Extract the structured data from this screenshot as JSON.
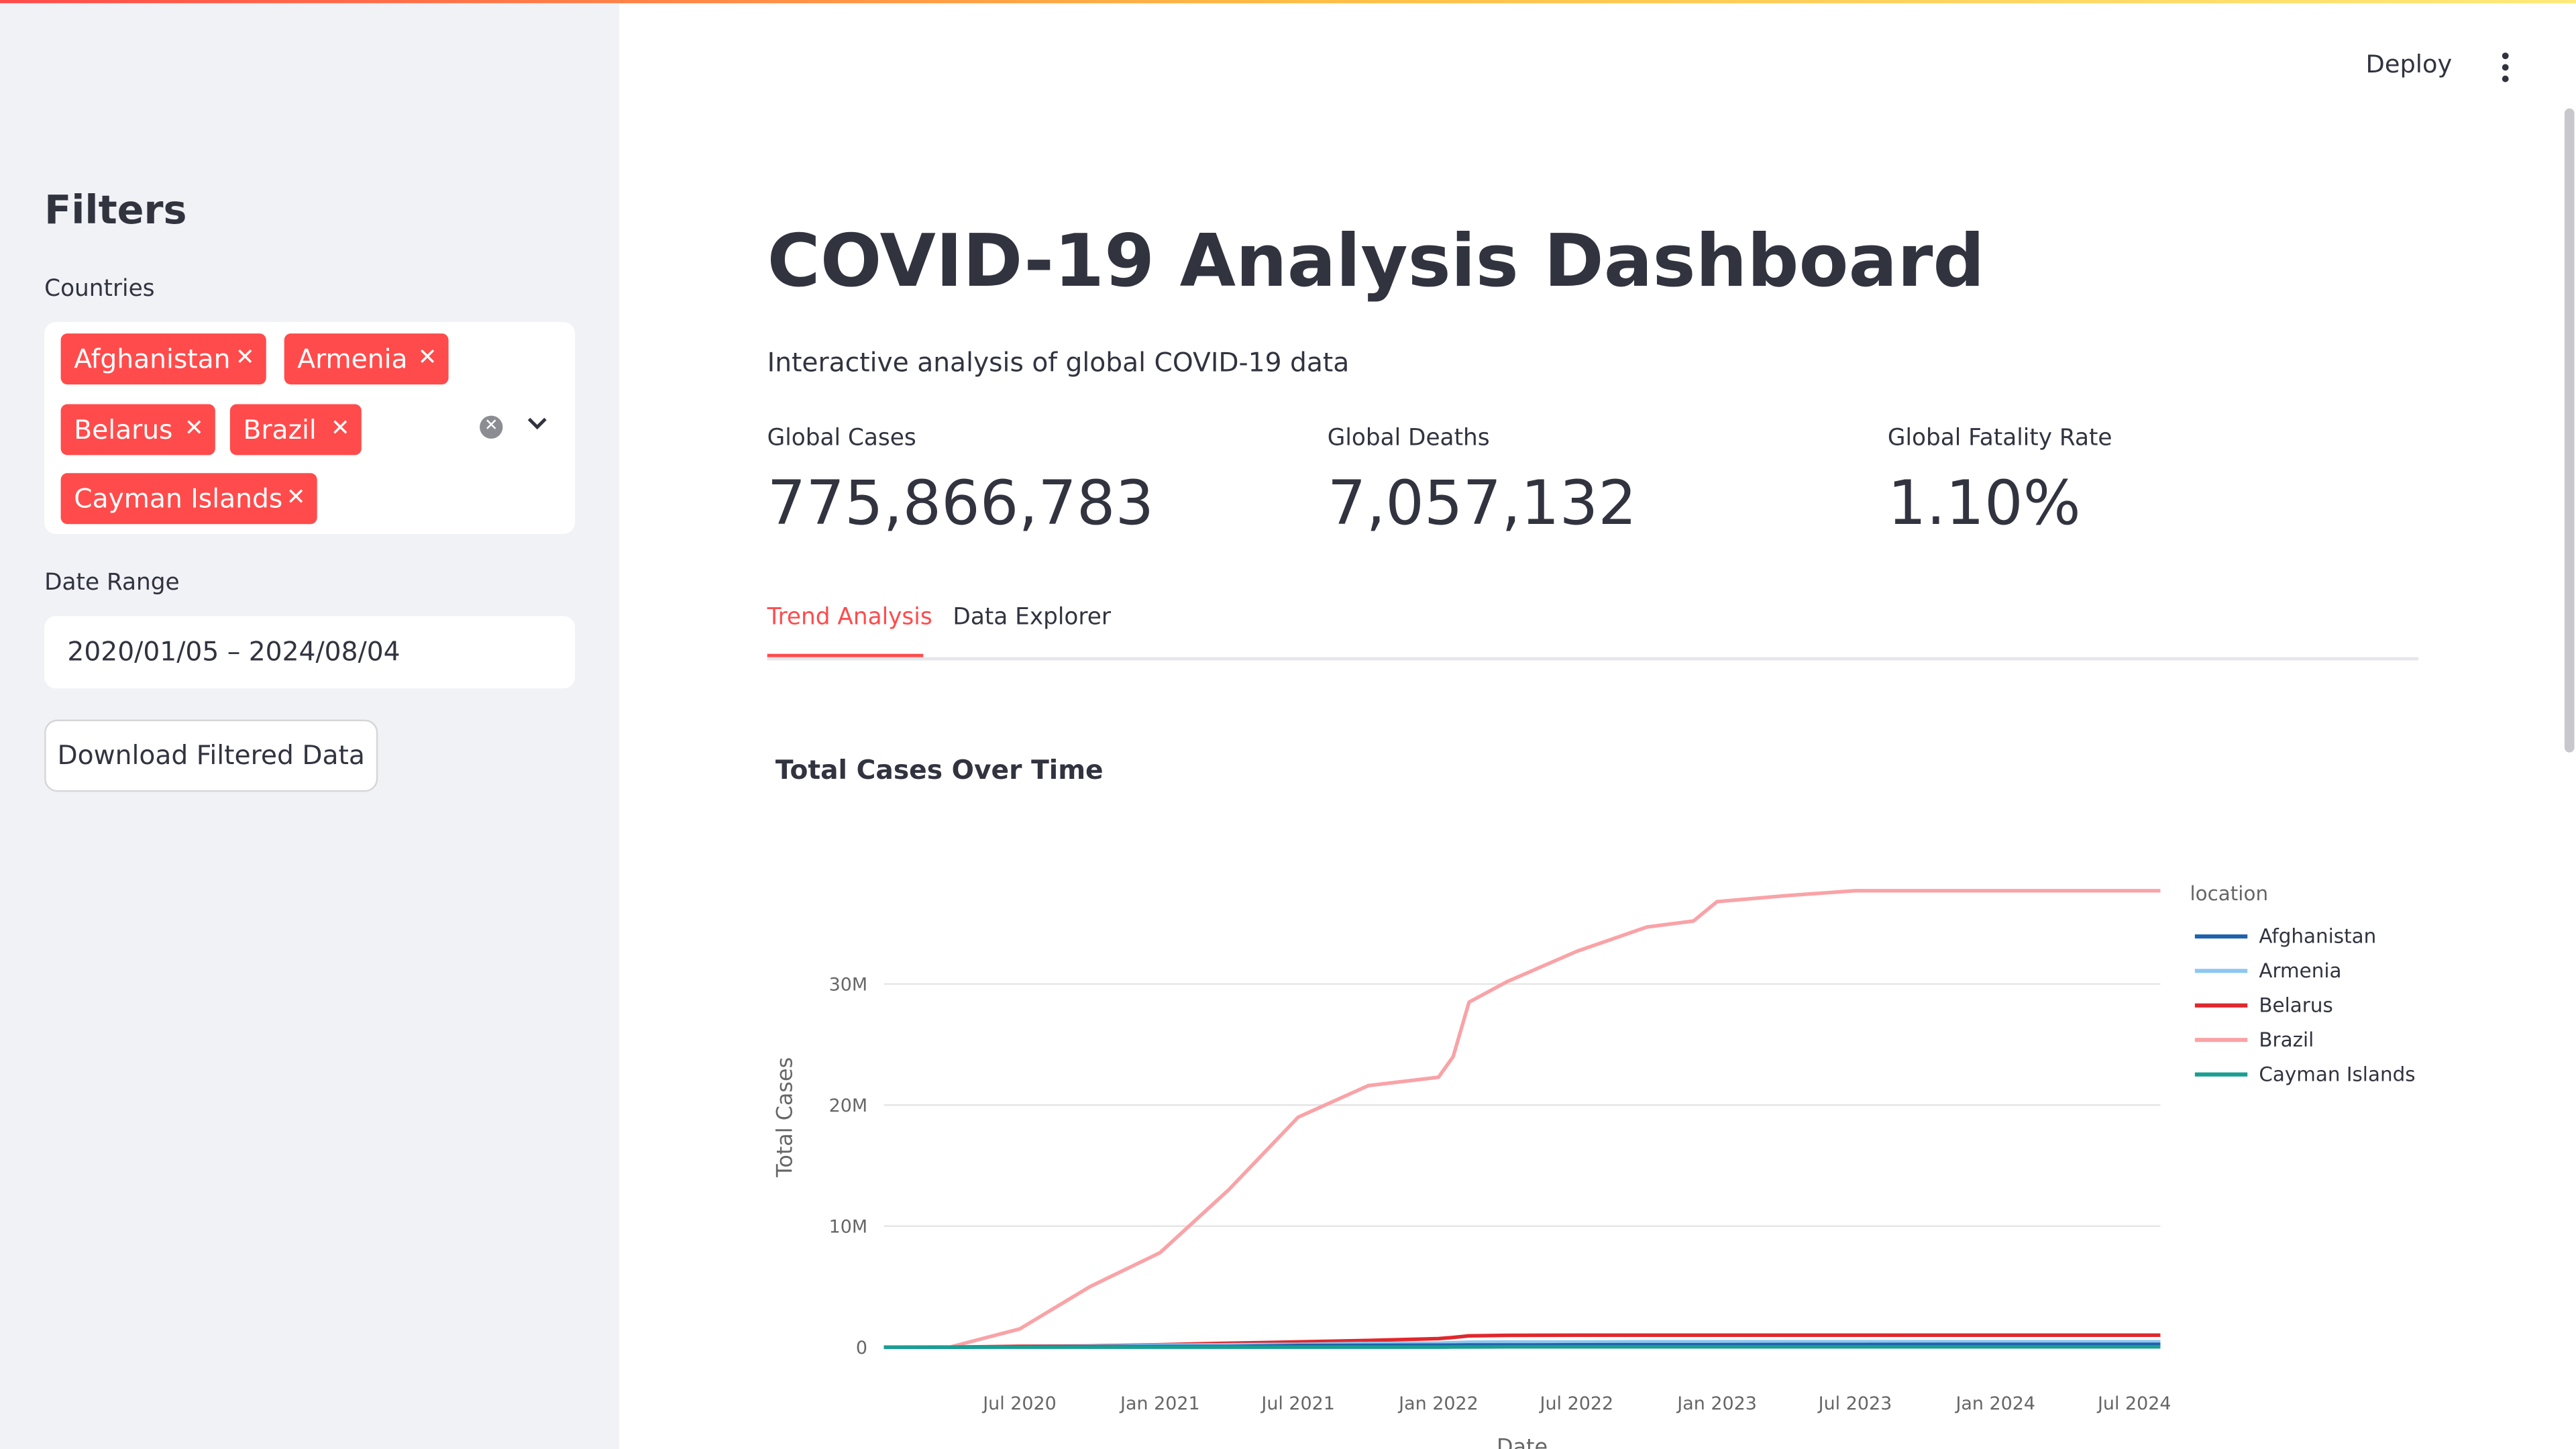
{
  "sidebar": {
    "heading": "Filters",
    "countries_label": "Countries",
    "selected_countries": [
      "Afghanistan",
      "Armenia",
      "Belarus",
      "Brazil",
      "Cayman Islands"
    ],
    "date_range_label": "Date Range",
    "date_range_value": "2020/01/05 – 2024/08/04",
    "download_label": "Download Filtered Data"
  },
  "header": {
    "deploy_label": "Deploy"
  },
  "main": {
    "title": "COVID-19 Analysis Dashboard",
    "subtitle": "Interactive analysis of global COVID-19 data",
    "metrics": [
      {
        "label": "Global Cases",
        "value": "775,866,783"
      },
      {
        "label": "Global Deaths",
        "value": "7,057,132"
      },
      {
        "label": "Global Fatality Rate",
        "value": "1.10%"
      }
    ],
    "tabs": [
      {
        "label": "Trend Analysis",
        "active": true
      },
      {
        "label": "Data Explorer",
        "active": false
      }
    ],
    "chart_title": "Total Cases Over Time"
  },
  "colors": {
    "accent": "#ff4b4b",
    "sidebar_bg": "#f0f2f6",
    "text": "#31333f"
  },
  "chart_data": {
    "type": "line",
    "title": "Total Cases Over Time",
    "xlabel": "Date",
    "ylabel": "Total Cases",
    "yticks": [
      "0",
      "10M",
      "20M",
      "30M"
    ],
    "xticks": [
      "Jul 2020",
      "Jan 2021",
      "Jul 2021",
      "Jan 2022",
      "Jul 2022",
      "Jan 2023",
      "Jul 2023",
      "Jan 2024",
      "Jul 2024"
    ],
    "legend_title": "location",
    "legend_position": "right",
    "grid": true,
    "ylim": [
      0,
      38000000
    ],
    "x": [
      "2020-01-05",
      "2020-04-01",
      "2020-07-01",
      "2020-10-01",
      "2021-01-01",
      "2021-04-01",
      "2021-07-01",
      "2021-10-01",
      "2022-01-01",
      "2022-01-20",
      "2022-02-10",
      "2022-04-01",
      "2022-07-01",
      "2022-10-01",
      "2022-12-01",
      "2023-01-01",
      "2023-04-01",
      "2023-07-01",
      "2024-01-01",
      "2024-08-04"
    ],
    "series": [
      {
        "name": "Afghanistan",
        "color": "#1f62ad",
        "values": [
          0,
          0,
          30000,
          40000,
          52000,
          57000,
          140000,
          155000,
          160000,
          165000,
          172000,
          178000,
          185000,
          200000,
          205000,
          210000,
          215000,
          221000,
          232000,
          235000
        ]
      },
      {
        "name": "Armenia",
        "color": "#8ec7f0",
        "values": [
          0,
          2000,
          30000,
          70000,
          160000,
          200000,
          230000,
          300000,
          340000,
          360000,
          410000,
          420000,
          425000,
          445000,
          446000,
          447000,
          448000,
          450000,
          452000,
          452000
        ]
      },
      {
        "name": "Belarus",
        "color": "#e0282e",
        "values": [
          0,
          3000,
          65000,
          90000,
          200000,
          330000,
          440000,
          550000,
          700000,
          800000,
          930000,
          980000,
          990000,
          994000,
          994000,
          994000,
          994000,
          994000,
          994000,
          994000
        ]
      },
      {
        "name": "Brazil",
        "color": "#f9a3a7",
        "values": [
          0,
          7000,
          1500000,
          5000000,
          7800000,
          13000000,
          19000000,
          21600000,
          22300000,
          24000000,
          28500000,
          30200000,
          32700000,
          34700000,
          35200000,
          36800000,
          37300000,
          37700000,
          37700000,
          37700000
        ]
      },
      {
        "name": "Cayman Islands",
        "color": "#1a9e92",
        "values": [
          0,
          50,
          200,
          230,
          320,
          500,
          700,
          2500,
          5000,
          9000,
          14000,
          24000,
          30000,
          31000,
          31300,
          31500,
          31500,
          31500,
          31500,
          31500
        ]
      }
    ]
  }
}
